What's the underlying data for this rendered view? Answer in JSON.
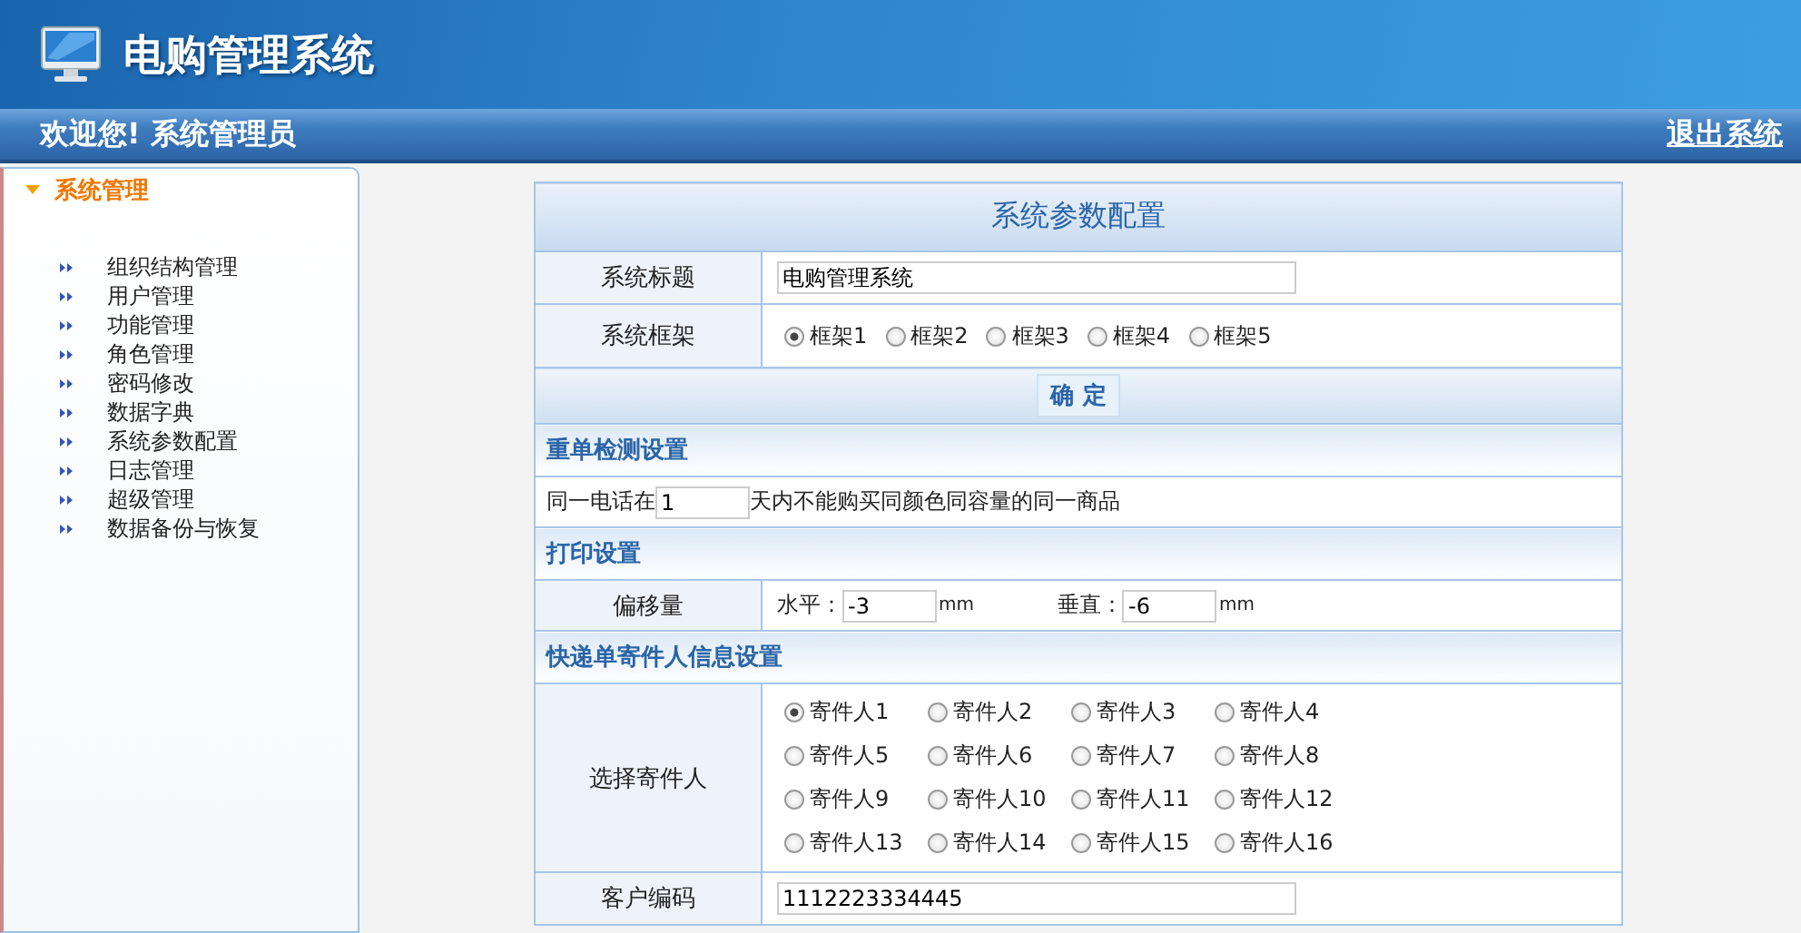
{
  "header": {
    "title": "电购管理系统"
  },
  "top_bar": {
    "welcome": "欢迎您! 系统管理员",
    "logout": "退出系统"
  },
  "sidebar": {
    "group": {
      "label": "系统管理",
      "expanded": true
    },
    "items": [
      {
        "label": "组织结构管理"
      },
      {
        "label": "用户管理"
      },
      {
        "label": "功能管理"
      },
      {
        "label": "角色管理"
      },
      {
        "label": "密码修改"
      },
      {
        "label": "数据字典"
      },
      {
        "label": "系统参数配置"
      },
      {
        "label": "日志管理"
      },
      {
        "label": "超级管理"
      },
      {
        "label": "数据备份与恢复"
      }
    ]
  },
  "form": {
    "title": "系统参数配置",
    "rows": [
      {
        "kind": "text",
        "label": "系统标题",
        "value": "电购管理系统"
      },
      {
        "kind": "radios",
        "label": "系统框架",
        "options": [
          {
            "label": "框架1",
            "selected": true
          },
          {
            "label": "框架2",
            "selected": false
          },
          {
            "label": "框架3",
            "selected": false
          },
          {
            "label": "框架4",
            "selected": false
          },
          {
            "label": "框架5",
            "selected": false
          }
        ]
      },
      {
        "kind": "button",
        "label": "确 定"
      },
      {
        "kind": "section",
        "label": "重单检测设置"
      },
      {
        "kind": "sentence",
        "before": "同一电话在",
        "value": "1",
        "after": "天内不能购买同颜色同容量的同一商品"
      },
      {
        "kind": "section",
        "label": "打印设置"
      },
      {
        "kind": "offset",
        "label": "偏移量",
        "h_label": "水平：",
        "h_value": "-3",
        "h_unit": "mm",
        "v_label": "垂直：",
        "v_value": "-6",
        "v_unit": "mm"
      },
      {
        "kind": "section",
        "label": "快递单寄件人信息设置"
      },
      {
        "kind": "radio-grid",
        "label": "选择寄件人",
        "options": [
          {
            "label": "寄件人1",
            "selected": true
          },
          {
            "label": "寄件人2",
            "selected": false
          },
          {
            "label": "寄件人3",
            "selected": false
          },
          {
            "label": "寄件人4",
            "selected": false
          },
          {
            "label": "寄件人5",
            "selected": false
          },
          {
            "label": "寄件人6",
            "selected": false
          },
          {
            "label": "寄件人7",
            "selected": false
          },
          {
            "label": "寄件人8",
            "selected": false
          },
          {
            "label": "寄件人9",
            "selected": false
          },
          {
            "label": "寄件人10",
            "selected": false
          },
          {
            "label": "寄件人11",
            "selected": false
          },
          {
            "label": "寄件人12",
            "selected": false
          },
          {
            "label": "寄件人13",
            "selected": false
          },
          {
            "label": "寄件人14",
            "selected": false
          },
          {
            "label": "寄件人15",
            "selected": false
          },
          {
            "label": "寄件人16",
            "selected": false
          }
        ]
      },
      {
        "kind": "text",
        "label": "客户编码",
        "value": "1112223334445"
      }
    ]
  }
}
